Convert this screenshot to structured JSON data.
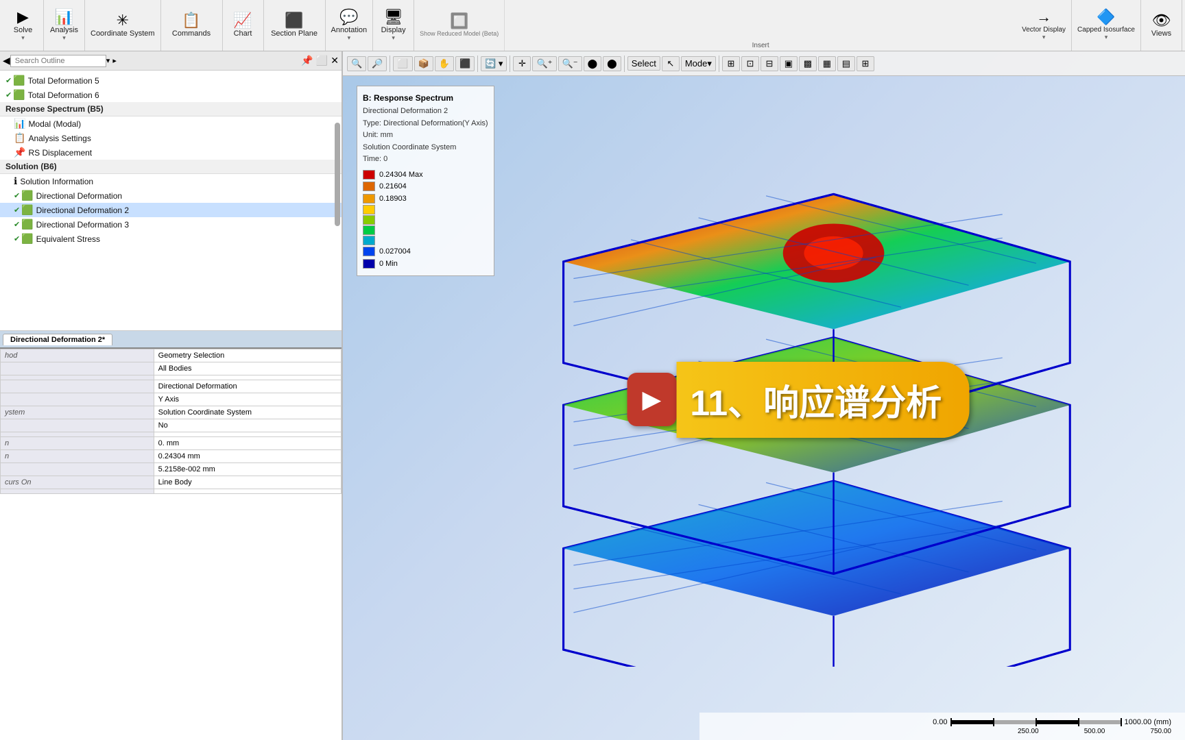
{
  "toolbar": {
    "groups": [
      {
        "id": "solve",
        "icon": "▶",
        "label": "Solve",
        "sublabel": ""
      },
      {
        "id": "analysis",
        "icon": "📊",
        "label": "Analysis",
        "sublabel": ""
      },
      {
        "id": "coordinate",
        "icon": "✳",
        "label": "Coordinate System",
        "sublabel": ""
      },
      {
        "id": "commands",
        "icon": "📋",
        "label": "Commands",
        "sublabel": ""
      },
      {
        "id": "chart",
        "icon": "📈",
        "label": "Chart",
        "sublabel": ""
      },
      {
        "id": "section-plane",
        "icon": "⬛",
        "label": "Section Plane",
        "sublabel": ""
      },
      {
        "id": "annotation",
        "icon": "💬",
        "label": "Annotation",
        "sublabel": ""
      },
      {
        "id": "display",
        "icon": "🖥",
        "label": "Display",
        "sublabel": ""
      },
      {
        "id": "show-reduced",
        "icon": "🔲",
        "label": "Show Reduced Model (Beta)",
        "sublabel": "Beta"
      },
      {
        "id": "vector-display",
        "icon": "→",
        "label": "Vector Display",
        "sublabel": ""
      },
      {
        "id": "capped-isosurface",
        "icon": "🔷",
        "label": "Capped Isosurface",
        "sublabel": ""
      },
      {
        "id": "views",
        "icon": "👁",
        "label": "Views",
        "sublabel": ""
      }
    ],
    "insert_label": "Insert"
  },
  "left_panel": {
    "search_placeholder": "Search Outline",
    "tree_items": [
      {
        "type": "item",
        "checked": true,
        "icon": "🟩",
        "label": "Total Deformation 5"
      },
      {
        "type": "item",
        "checked": true,
        "icon": "🟩",
        "label": "Total Deformation 6"
      },
      {
        "type": "header",
        "label": "Response Spectrum (B5)"
      },
      {
        "type": "item",
        "checked": false,
        "icon": "📊",
        "label": "Modal (Modal)"
      },
      {
        "type": "item",
        "checked": false,
        "icon": "📋",
        "label": "Analysis Settings"
      },
      {
        "type": "item",
        "checked": false,
        "icon": "📌",
        "label": "RS Displacement"
      },
      {
        "type": "header",
        "label": "Solution (B6)"
      },
      {
        "type": "item",
        "checked": false,
        "icon": "ℹ",
        "label": "Solution Information"
      },
      {
        "type": "item",
        "checked": true,
        "icon": "🟩",
        "label": "Directional Deformation"
      },
      {
        "type": "item",
        "checked": true,
        "icon": "🟩",
        "label": "Directional Deformation 2"
      },
      {
        "type": "item",
        "checked": true,
        "icon": "🟩",
        "label": "Directional Deformation 3"
      },
      {
        "type": "item",
        "checked": true,
        "icon": "🟩",
        "label": "Equivalent Stress"
      }
    ],
    "active_tab": "Directional Deformation 2*",
    "properties": [
      {
        "key": "hod",
        "value": "Geometry Selection"
      },
      {
        "key": "",
        "value": "All Bodies"
      },
      {
        "key": "",
        "value": ""
      },
      {
        "key": "",
        "value": "Directional Deformation"
      },
      {
        "key": "",
        "value": "Y Axis"
      },
      {
        "key": "ystem",
        "value": "Solution Coordinate System"
      },
      {
        "key": "",
        "value": "No"
      },
      {
        "key": "",
        "value": ""
      },
      {
        "key": "n",
        "value": "0. mm"
      },
      {
        "key": "n",
        "value": "0.24304 mm"
      },
      {
        "key": "",
        "value": "5.2158e-002 mm"
      },
      {
        "key": "curs On",
        "value": "Line Body"
      }
    ]
  },
  "viewport": {
    "toolbar_buttons": [
      "🔍",
      "🔎",
      "⬜",
      "📦",
      "🎯",
      "⬛",
      "🔄",
      "✛",
      "🔍+",
      "🔍-",
      "⬤",
      "⬤"
    ],
    "select_label": "Select",
    "mode_label": "Mode"
  },
  "legend": {
    "title": "B: Response Spectrum",
    "sub1": "Directional Deformation 2",
    "sub2": "Type: Directional Deformation(Y Axis)",
    "sub3": "Unit: mm",
    "sub4": "Solution Coordinate System",
    "sub5": "Time: 0",
    "color_entries": [
      {
        "color": "#cc0000",
        "value": "0.24304 Max"
      },
      {
        "color": "#dd6600",
        "value": "0.21604"
      },
      {
        "color": "#ee9900",
        "value": "0.18903"
      },
      {
        "color": "#ffcc00",
        "value": ""
      },
      {
        "color": "#88cc00",
        "value": ""
      },
      {
        "color": "#00aa44",
        "value": ""
      },
      {
        "color": "#0088bb",
        "value": ""
      },
      {
        "color": "#0044cc",
        "value": "0.027004"
      },
      {
        "color": "#0000aa",
        "value": "0 Min"
      }
    ]
  },
  "scale_bar": {
    "values": [
      "0.00",
      "250.00",
      "500.00",
      "750.00",
      "1000.00"
    ],
    "unit": "(mm)"
  },
  "banner": {
    "text": "11、响应谱分析"
  }
}
